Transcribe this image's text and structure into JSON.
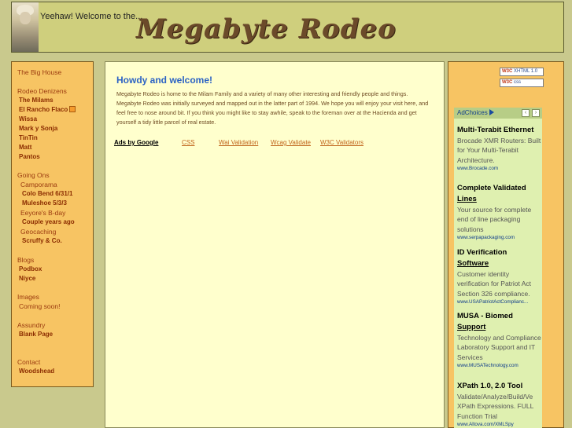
{
  "header": {
    "welcome": "Yeehaw! Welcome to the...",
    "logo": "Megabyte Rodeo"
  },
  "sidebar": {
    "items": [
      {
        "label": "The Big House",
        "type": "sec"
      },
      {
        "label": "",
        "type": "gap"
      },
      {
        "label": "Rodeo Denizens",
        "type": "sec"
      },
      {
        "label": "The Milams",
        "type": "item"
      },
      {
        "label": "El Rancho Flaco",
        "type": "item",
        "rss": true
      },
      {
        "label": "Wissa",
        "type": "item"
      },
      {
        "label": "Mark y Sonja",
        "type": "item"
      },
      {
        "label": "TinTin",
        "type": "item"
      },
      {
        "label": "Matt",
        "type": "item"
      },
      {
        "label": "Pantos",
        "type": "item"
      },
      {
        "label": "",
        "type": "gap"
      },
      {
        "label": "Going Ons",
        "type": "sec"
      },
      {
        "label": "Camporama",
        "type": "sub"
      },
      {
        "label": "Colo Bend 6/31/1",
        "type": "subitem"
      },
      {
        "label": "Muleshoe 5/3/3",
        "type": "subitem"
      },
      {
        "label": "Eeyore's B-day",
        "type": "sub"
      },
      {
        "label": "Couple years ago",
        "type": "subitem"
      },
      {
        "label": "Geocaching",
        "type": "sub"
      },
      {
        "label": "Scruffy & Co.",
        "type": "subitem"
      },
      {
        "label": "",
        "type": "gap"
      },
      {
        "label": "Blogs",
        "type": "sec"
      },
      {
        "label": "Podbox",
        "type": "item"
      },
      {
        "label": "Niyce",
        "type": "item"
      },
      {
        "label": "",
        "type": "gap"
      },
      {
        "label": "Images",
        "type": "sec"
      },
      {
        "label": "Coming soon!",
        "type": "plain"
      },
      {
        "label": "",
        "type": "gap"
      },
      {
        "label": "Assundry",
        "type": "sec"
      },
      {
        "label": "Blank Page",
        "type": "item"
      },
      {
        "label": "",
        "type": "gap"
      },
      {
        "label": "",
        "type": "gap"
      },
      {
        "label": "Contact",
        "type": "sec"
      },
      {
        "label": "Woodshead",
        "type": "item"
      }
    ]
  },
  "main": {
    "heading": "Howdy and welcome!",
    "intro": "Megabyte Rodeo is home to the Milam Family and a variety of many other interesting and friendly people and things. Megabyte Rodeo was initially surveyed and mapped out in the latter part of 1994. We hope you will enjoy your visit here, and feel free to nose around bit. If you think you might like to stay awhile, speak to the foreman over at the Hacienda and get yourself a tidy little parcel of real estate.",
    "ads_by": "Ads by Google",
    "links": [
      "CSS",
      "Wai Validation",
      "Wcag Validate",
      "W3C Validators"
    ]
  },
  "right": {
    "badges": [
      {
        "label": "W3C",
        "sub": "XHTML 1.0"
      },
      {
        "label": "W3C",
        "sub": "css"
      }
    ],
    "adchoices": "AdChoices",
    "ads": [
      {
        "title": "Multi-Terabit Ethernet",
        "title_u": "",
        "desc": "Brocade XMR Routers: Built for Your Multi-Terabit Architecture.",
        "url": "www.Brocade.com"
      },
      {
        "title": "Complete Validated",
        "title_u": "Lines",
        "desc": "Your source for complete end of line packaging solutions",
        "url": "www.serpapackaging.com"
      },
      {
        "title": "ID Verification",
        "title_u": "Software",
        "desc": "Customer identity verification for Patriot Act Section 326 compliance.",
        "url": "www.USAPatriotActComplianc..."
      },
      {
        "title": "MUSA - Biomed",
        "title_u": "Support",
        "desc": "Technology and Compliance Laboratory Support and IT Services",
        "url": "www.MUSATechnology.com"
      },
      {
        "title": "XPath 1.0, 2.0 Tool",
        "title_u": "",
        "desc": "Validate/Analyze/Build/Ve XPath Expressions. FULL Function Trial",
        "url": "www.Altova.com/XMLSpy"
      }
    ]
  }
}
